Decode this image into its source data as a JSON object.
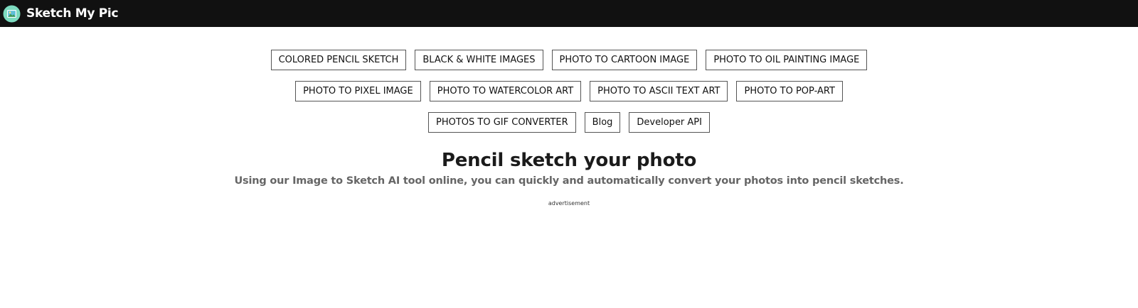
{
  "header": {
    "brand": "Sketch My Pic",
    "logo_icon": "image-landscape-icon",
    "background": "#111111"
  },
  "nav": {
    "rows": [
      [
        "COLORED PENCIL SKETCH",
        "BLACK & WHITE IMAGES",
        "PHOTO TO CARTOON IMAGE",
        "PHOTO TO OIL PAINTING IMAGE"
      ],
      [
        "PHOTO TO PIXEL IMAGE",
        "PHOTO TO WATERCOLOR ART",
        "PHOTO TO ASCII TEXT ART",
        "PHOTO TO POP-ART"
      ],
      [
        "PHOTOS TO GIF CONVERTER",
        "Blog",
        "Developer API"
      ]
    ]
  },
  "hero": {
    "title": "Pencil sketch your photo",
    "subtitle": "Using our Image to Sketch AI tool online, you can quickly and automatically convert your photos into pencil sketches."
  },
  "ad": {
    "label": "advertisement"
  }
}
